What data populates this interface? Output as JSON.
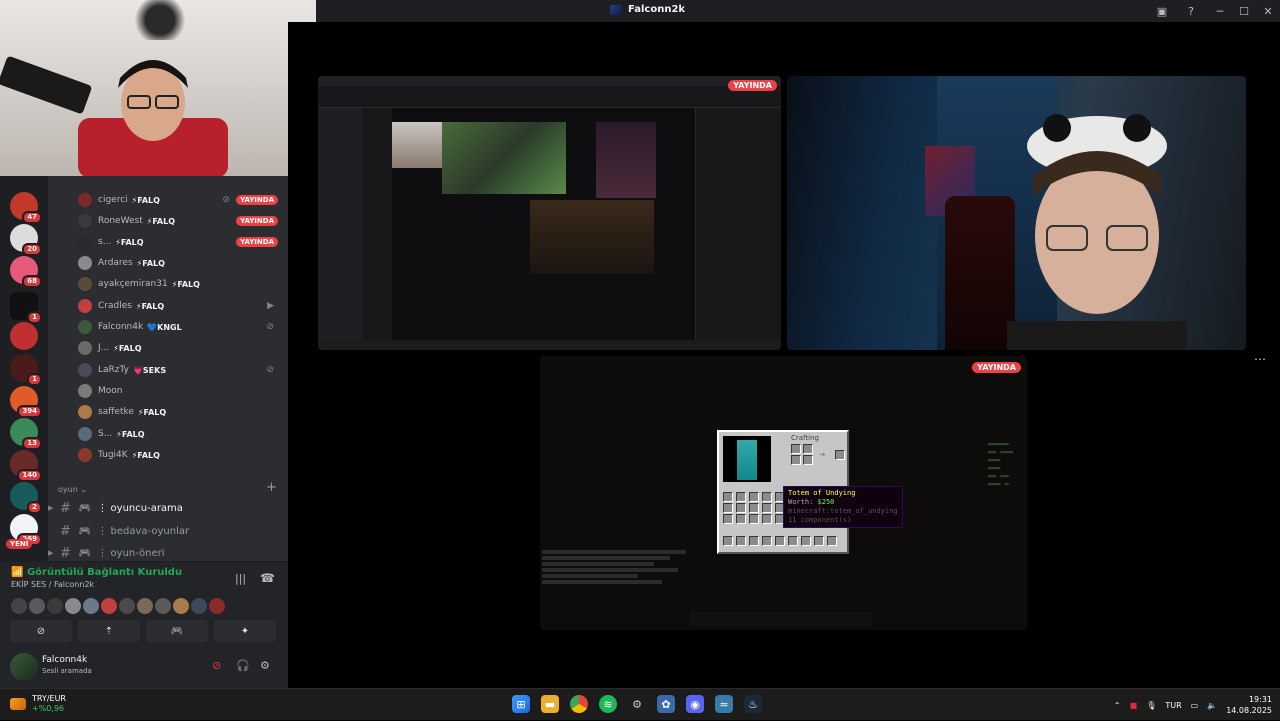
{
  "window": {
    "title": "Falconn2k"
  },
  "servers": [
    {
      "badge": "47"
    },
    {
      "badge": "20"
    },
    {
      "badge": "68"
    },
    {
      "badge": "1"
    },
    {
      "badge": ""
    },
    {
      "badge": "1"
    },
    {
      "badge": "394"
    },
    {
      "badge": "13"
    },
    {
      "badge": "140"
    },
    {
      "badge": "2"
    },
    {
      "badge": "269"
    }
  ],
  "servers_new_label": "YENİ",
  "voice_users": [
    {
      "name": "cigerci",
      "tag": "⚡FALQ",
      "live": "YAYINDA",
      "color": "#7a2a2a"
    },
    {
      "name": "RoneWest",
      "tag": "⚡FALQ",
      "live": "YAYINDA",
      "color": "#3a3a3a"
    },
    {
      "name": "s...",
      "tag": "⚡FALQ",
      "live": "YAYINDA",
      "color": "#2a2a2a"
    },
    {
      "name": "Ardares",
      "tag": "⚡FALQ",
      "live": "",
      "color": "#8a8a8a"
    },
    {
      "name": "ayakçemiran31",
      "tag": "⚡FALQ",
      "live": "",
      "color": "#5a4a3a"
    },
    {
      "name": "Cradles",
      "tag": "⚡FALQ",
      "live": "",
      "color": "#c04040"
    },
    {
      "name": "Falconn4k",
      "tag": "💙KNGL",
      "live": "",
      "color": "#3a5a3a"
    },
    {
      "name": "J...",
      "tag": "⚡FALQ",
      "live": "",
      "color": "#6a6a6a"
    },
    {
      "name": "LaRzTy",
      "tag": "💗SEKS",
      "live": "",
      "color": "#4a4a5a"
    },
    {
      "name": "Moon",
      "tag": "",
      "live": "",
      "color": "#7a7a7a"
    },
    {
      "name": "saffetke",
      "tag": "⚡FALQ",
      "live": "",
      "color": "#aa7a4a"
    },
    {
      "name": "S...",
      "tag": "⚡FALQ",
      "live": "",
      "color": "#5a6a7a"
    },
    {
      "name": "Tugi4K",
      "tag": "⚡FALQ",
      "live": "",
      "color": "#8a3a2a"
    }
  ],
  "category": {
    "label": "oyun"
  },
  "channels": [
    {
      "name": "⋮ oyuncu-arama",
      "active": true
    },
    {
      "name": "⋮ bedava-oyunlar",
      "active": false
    },
    {
      "name": "⋮ oyun-öneri",
      "active": false
    }
  ],
  "voice": {
    "status": "Görüntülü Bağlantı Kuruldu",
    "channel": "EKİP SES / Falconn2k"
  },
  "user": {
    "name": "Falconn4k",
    "status": "Sesli aramada"
  },
  "stage": {
    "live_label": "YAYINDA"
  },
  "minecraft": {
    "crafting_label": "Crafting",
    "tooltip_name": "Totem of Undying",
    "tooltip_worth_label": "Worth:",
    "tooltip_worth_value": "$250",
    "tooltip_id": "minecraft:totem_of_undying",
    "tooltip_components": "11 component(s)"
  },
  "taskbar": {
    "ticker": "TRY/EUR",
    "change": "+%0,96",
    "lang": "TUR",
    "time": "19:31",
    "date": "14.08.2025"
  }
}
